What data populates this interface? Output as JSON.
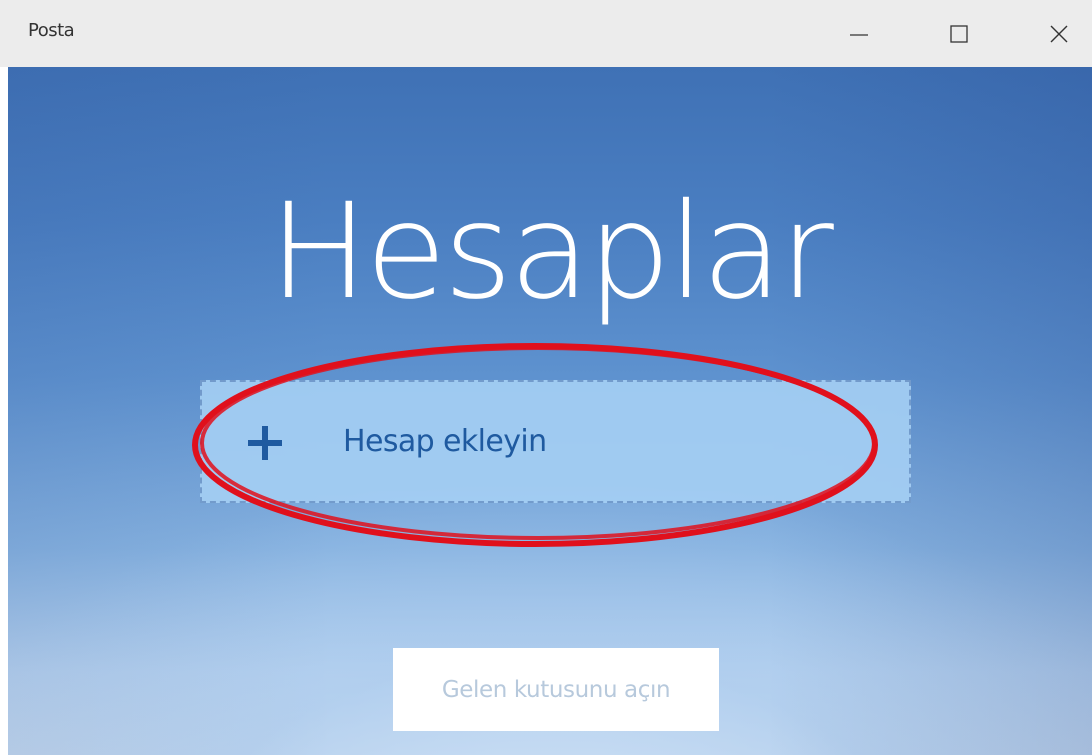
{
  "window": {
    "app_title": "Posta",
    "controls": {
      "minimize_icon": "minimize-icon",
      "maximize_icon": "maximize-icon",
      "close_icon": "close-icon"
    }
  },
  "main": {
    "heading": "Hesaplar",
    "add_account": {
      "label": "Hesap ekleyin",
      "icon": "plus-icon"
    },
    "open_inbox_label": "Gelen kutusunu açın"
  },
  "annotation": {
    "color": "#e0101c"
  },
  "colors": {
    "accent": "#1f5aa0",
    "titlebar": "#ececec"
  }
}
